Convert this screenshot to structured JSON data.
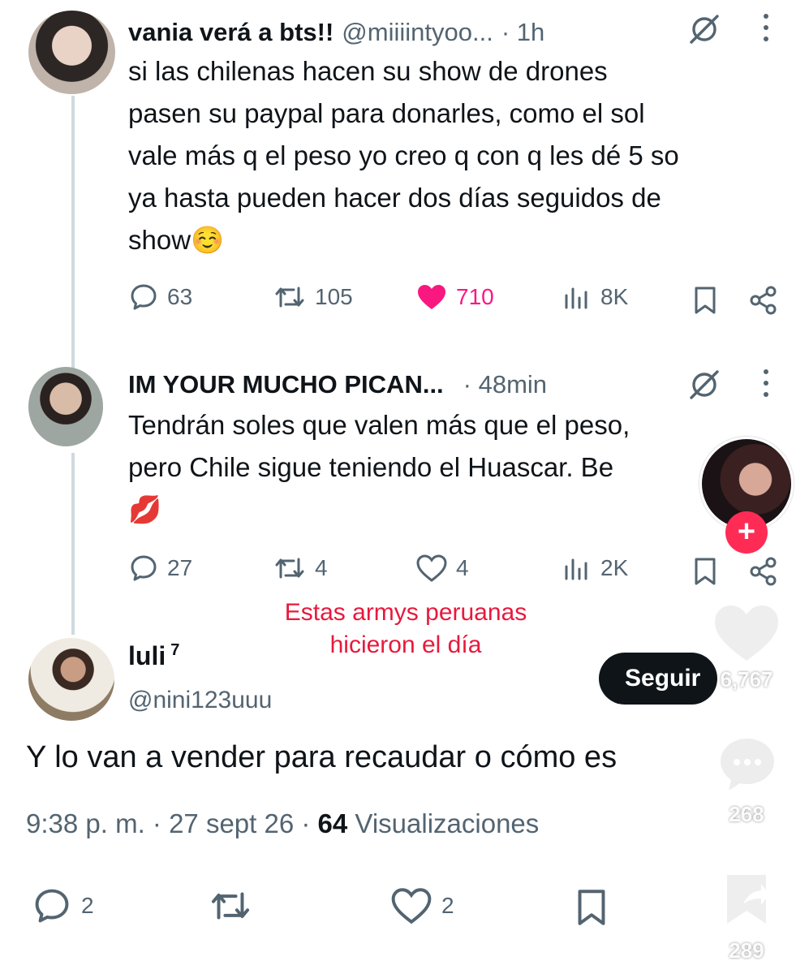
{
  "tweet1": {
    "name": "vania verá a bts!!",
    "handle": "@miiiintyoo...",
    "time": "· 1h",
    "lines": [
      "si las chilenas hacen su show de drones",
      "pasen su paypal para donarles, como el sol",
      "vale más q el peso yo creo q con q les dé 5 so",
      "ya hasta pueden hacer dos días seguidos de",
      "show☺️"
    ],
    "replies": "63",
    "reposts": "105",
    "likes": "710",
    "views": "8K"
  },
  "tweet2": {
    "name": "IM YOUR MUCHO PICAN...",
    "time": "· 48min",
    "lines": [
      "Tendrán soles que valen más que el peso,",
      "pero Chile sigue teniendo el Huascar. Be",
      "💋"
    ],
    "replies": "27",
    "reposts": "4",
    "likes": "4",
    "views": "2K"
  },
  "overlay": {
    "caption_line1": "Estas armys peruanas",
    "caption_line2": "hicieron el día",
    "like_count": "6,767",
    "comment_count": "268",
    "share_count": "289",
    "follow_label": "Seguir"
  },
  "reply": {
    "name": "luli",
    "superscript": "7",
    "handle": "@nini123uuu",
    "text": "Y lo van a vender para recaudar o cómo es",
    "meta_time": "9:38 p. m. · 27 sept 26 · ",
    "meta_views_count": "64",
    "meta_views_label": " Visualizaciones",
    "replies": "2",
    "likes": "2"
  },
  "colors": {
    "text": "#0f1419",
    "secondary": "#536471",
    "like": "#f91880",
    "caption": "#e8193c",
    "tiktok_plus": "#fe2c55"
  }
}
